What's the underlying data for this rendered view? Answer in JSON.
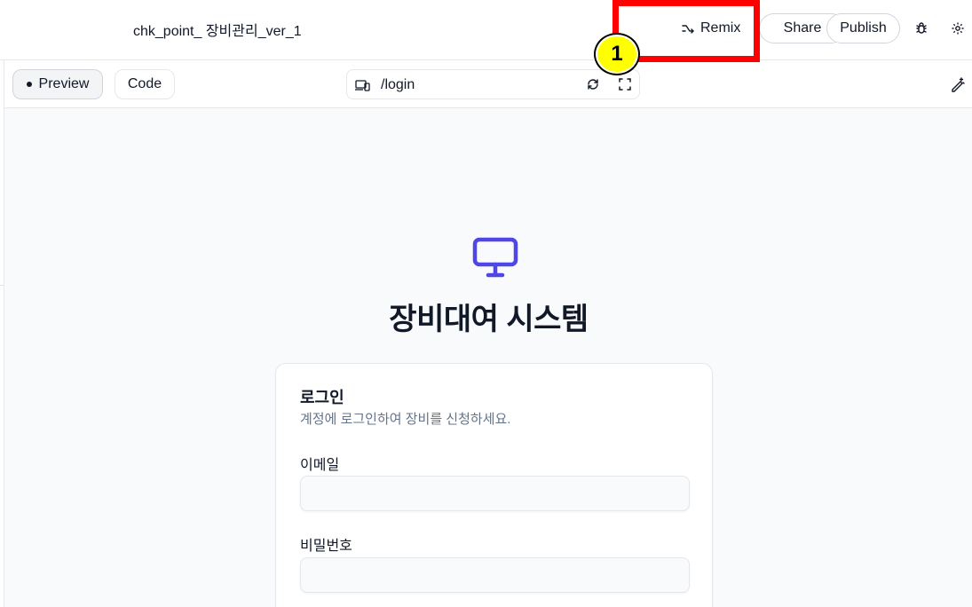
{
  "header": {
    "project_title": "chk_point_ 장비관리_ver_1",
    "remix_label": "Remix",
    "share_label": "Share",
    "publish_label": "Publish"
  },
  "annotation": {
    "badge_number": "1",
    "highlight_color": "#ff0000",
    "badge_color": "#ffff00"
  },
  "toolbar": {
    "preview_label": "Preview",
    "code_label": "Code",
    "url_path": "/login"
  },
  "preview": {
    "app_title": "장비대여 시스템",
    "accent_color": "#4f46e5",
    "login_card": {
      "title": "로그인",
      "description": "계정에 로그인하여 장비를 신청하세요.",
      "email_label": "이메일",
      "email_value": "",
      "password_label": "비밀번호",
      "password_value": ""
    }
  },
  "icons": {
    "remix": "shuffle-arrow-icon",
    "bug": "bug-icon",
    "settings": "gear-icon",
    "device": "device-toggle-icon",
    "refresh": "refresh-icon",
    "fullscreen": "expand-icon",
    "edit": "magic-pen-icon",
    "app_logo": "monitor-icon"
  }
}
